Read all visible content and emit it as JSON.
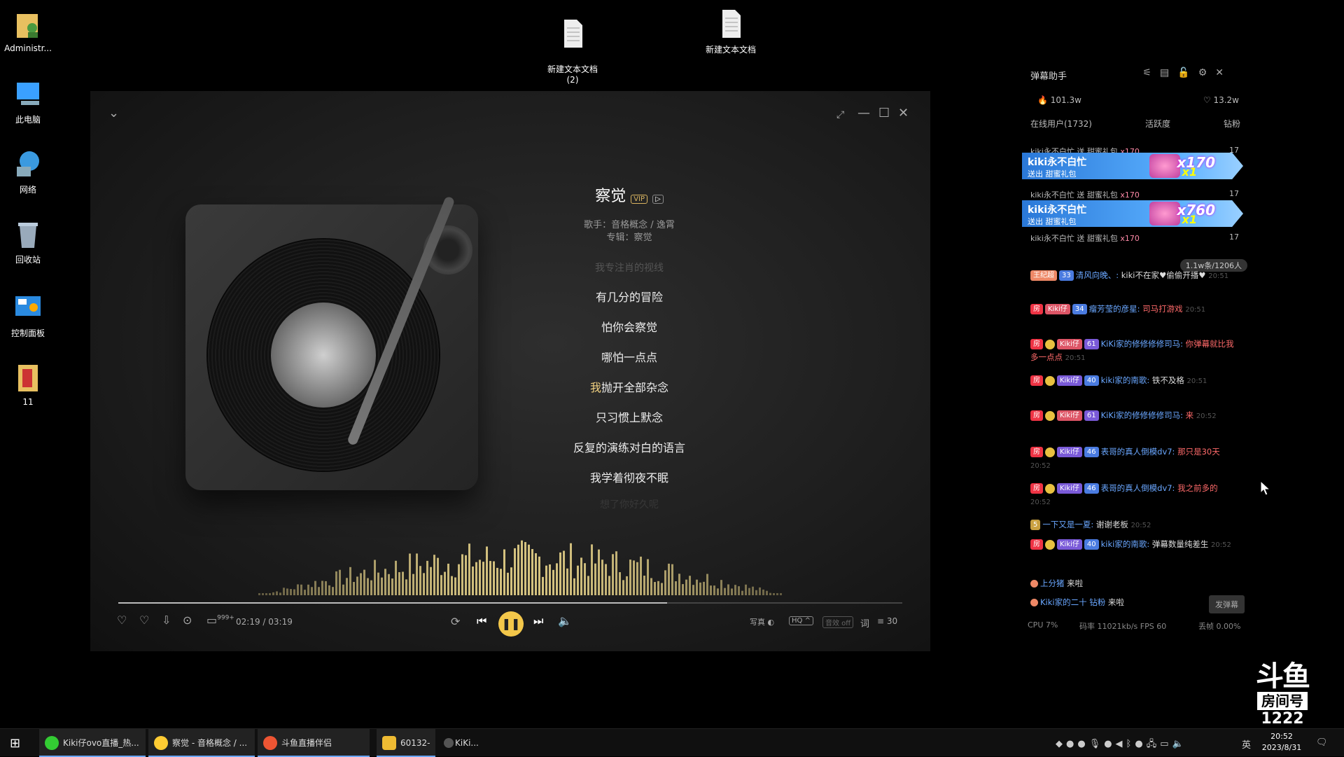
{
  "desktop": {
    "icons": [
      {
        "label": "Administr..."
      },
      {
        "label": "此电脑"
      },
      {
        "label": "网络"
      },
      {
        "label": "回收站"
      },
      {
        "label": "控制面板"
      },
      {
        "label": "11"
      },
      {
        "label": "新建文本文档\n(2)"
      },
      {
        "label": "新建文本文档"
      }
    ]
  },
  "player": {
    "title": "察觉",
    "singer": "歌手：音格概念 / 逸霄",
    "album": "专辑：察觉",
    "lyrics": [
      {
        "text": "我专注肖的视线",
        "fade": true
      },
      {
        "text": "有几分的冒险"
      },
      {
        "text": "怕你会察觉"
      },
      {
        "text": "哪怕一点点"
      },
      {
        "hl": "我",
        "text": "抛开全部杂念"
      },
      {
        "text": "只习惯上默念"
      },
      {
        "text": "反复的演练对白的语言"
      },
      {
        "text": "我学着彻夜不眠"
      },
      {
        "text": "想了你好久呢",
        "fade": true
      }
    ],
    "time": "02:19 / 03:19",
    "progress": 0.7,
    "comment_count": "999+",
    "photo_label": "写真",
    "quality": "HQ ^",
    "effect": "音效 off",
    "lyric_icon": "词",
    "playlist_count": "30"
  },
  "danmu": {
    "title": "弹幕助手",
    "hot": "101.3w",
    "likes": "13.2w",
    "tabs": [
      "在线用户(1732)",
      "活跃度",
      "钻粉"
    ],
    "gift_lines": [
      {
        "text": "kiki永不白忙 送 甜蜜礼包",
        "count": "x170",
        "lv": "17"
      },
      {
        "text": "kiki永不白忙 送 甜蜜礼包",
        "count": "x170",
        "lv": "17"
      },
      {
        "text": "kiki永不白忙 送 甜蜜礼包",
        "count": "x170",
        "lv": "17"
      }
    ],
    "gift_banners": [
      {
        "name": "kiki永不白忙",
        "sub": "送出  甜蜜礼包",
        "count": "x170",
        "x1": "x1"
      },
      {
        "name": "kiki永不白忙",
        "sub": "送出  甜蜜礼包",
        "count": "x760",
        "x1": "x1"
      }
    ],
    "count_pill": "1.1w条/1206人",
    "messages": [
      {
        "badges": "王纪超",
        "fan": "33",
        "user": "清风向晚、:",
        "text": "kiki不在家♥偷偷开播♥",
        "time": "20:51"
      },
      {
        "badges": "Kiki仔",
        "fan": "34",
        "user": "瘤芳莹的彦星:",
        "text": "司马打游戏",
        "time": "20:51"
      },
      {
        "badges": "Kiki仔",
        "fan": "61",
        "user": "KiKi家的修修修修司马:",
        "text": "你弹幕就比我多一点点",
        "time": "20:51"
      },
      {
        "badges": "Kiki仔",
        "fan": "40",
        "user": "kiki家的南歌:",
        "text": "铁不及格",
        "time": "20:51"
      },
      {
        "badges": "Kiki仔",
        "fan": "61",
        "user": "KiKi家的修修修修司马:",
        "text": "来",
        "time": "20:52"
      },
      {
        "badges": "Kiki仔",
        "fan": "46",
        "user": "表哥的真人倒模dv7:",
        "text": "那只是30天",
        "time": "20:52"
      },
      {
        "badges": "Kiki仔",
        "fan": "46",
        "user": "表哥的真人倒模dv7:",
        "text": "我之前多的",
        "time": "20:52"
      },
      {
        "badges": "5",
        "fan": "",
        "user": "一下又是一夏:",
        "text": "谢谢老板",
        "time": "20:52"
      },
      {
        "badges": "Kiki仔",
        "fan": "40",
        "user": "kiki家的南歌:",
        "text": "弹幕数量纯差生",
        "time": "20:52"
      }
    ],
    "enter": [
      {
        "user": "上分猪",
        "text": "来啦"
      },
      {
        "user": "Kiki家的二十 钻粉",
        "text": "来啦"
      }
    ],
    "send_label": "发弹幕",
    "cpu": "CPU 7%",
    "bitrate": "码率 11021kb/s FPS 60",
    "drop": "丢帧 0.00%"
  },
  "logo": {
    "room_label": "房间号",
    "room_no": "1222"
  },
  "taskbar": {
    "apps": [
      "Kiki仔ovo直播_热...",
      "察觉 - 音格概念 / ...",
      "斗鱼直播伴侣",
      "60132-",
      "KiKi..."
    ],
    "ime": "英",
    "time": "20:52",
    "date": "2023/8/31"
  },
  "colors": {
    "accent": "#f3c74a",
    "link": "#6aa7ff"
  }
}
